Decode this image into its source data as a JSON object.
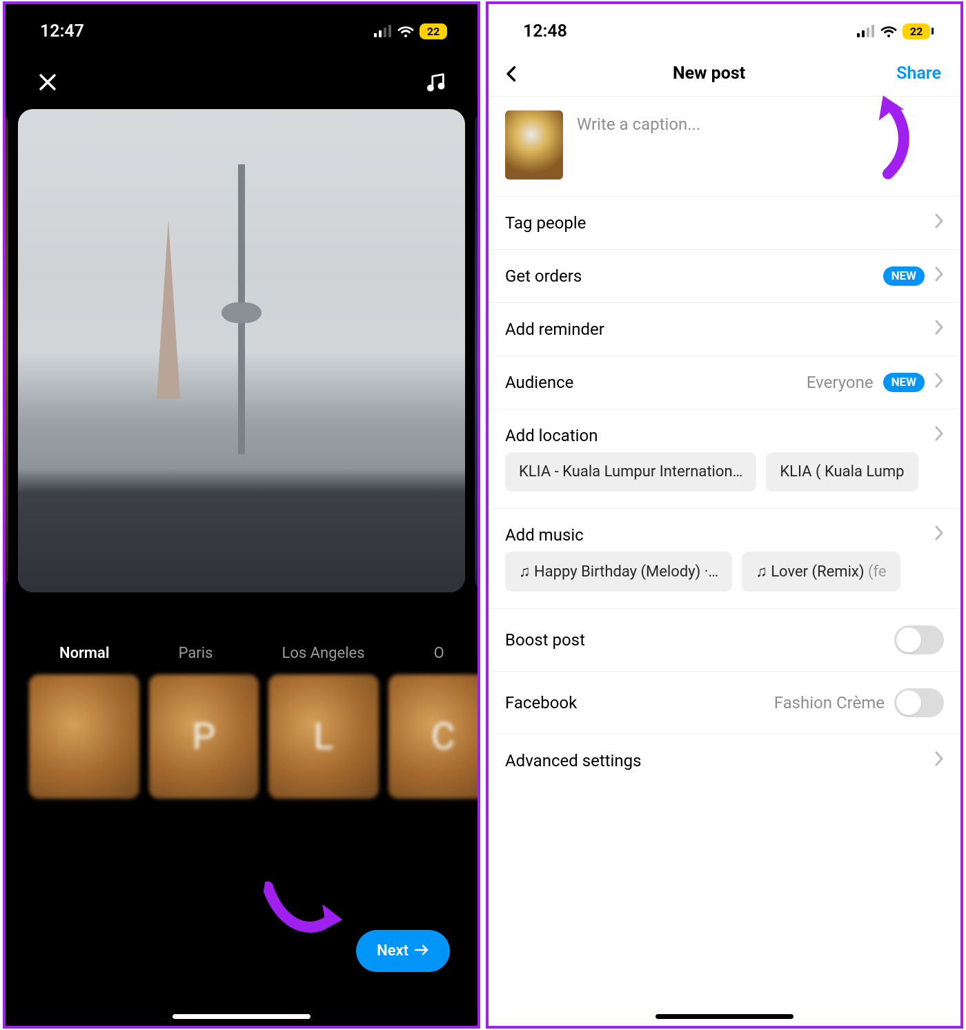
{
  "left": {
    "status": {
      "time": "12:47",
      "battery": "22"
    },
    "filters": [
      "Normal",
      "Paris",
      "Los Angeles",
      "O"
    ],
    "thumb_letters": [
      "",
      "P",
      "L",
      "C"
    ],
    "next_label": "Next"
  },
  "right": {
    "status": {
      "time": "12:48",
      "battery": "22"
    },
    "nav": {
      "title": "New post",
      "share": "Share"
    },
    "caption_placeholder": "Write a caption...",
    "rows": {
      "tag_people": "Tag people",
      "get_orders": "Get orders",
      "get_orders_badge": "NEW",
      "add_reminder": "Add reminder",
      "audience": "Audience",
      "audience_value": "Everyone",
      "audience_badge": "NEW",
      "add_location": "Add location",
      "add_music": "Add music",
      "boost_post": "Boost post",
      "facebook": "Facebook",
      "facebook_value": "Fashion Crème",
      "advanced": "Advanced settings"
    },
    "location_chips": [
      "KLIA - Kuala Lumpur Internation…",
      "KLIA ( Kuala Lump"
    ],
    "music_chips": [
      {
        "icon": "♫",
        "label": "Happy Birthday (Melody) ·…"
      },
      {
        "icon": "♫",
        "label": "Lover (Remix)",
        "muted": " (fe"
      }
    ]
  }
}
